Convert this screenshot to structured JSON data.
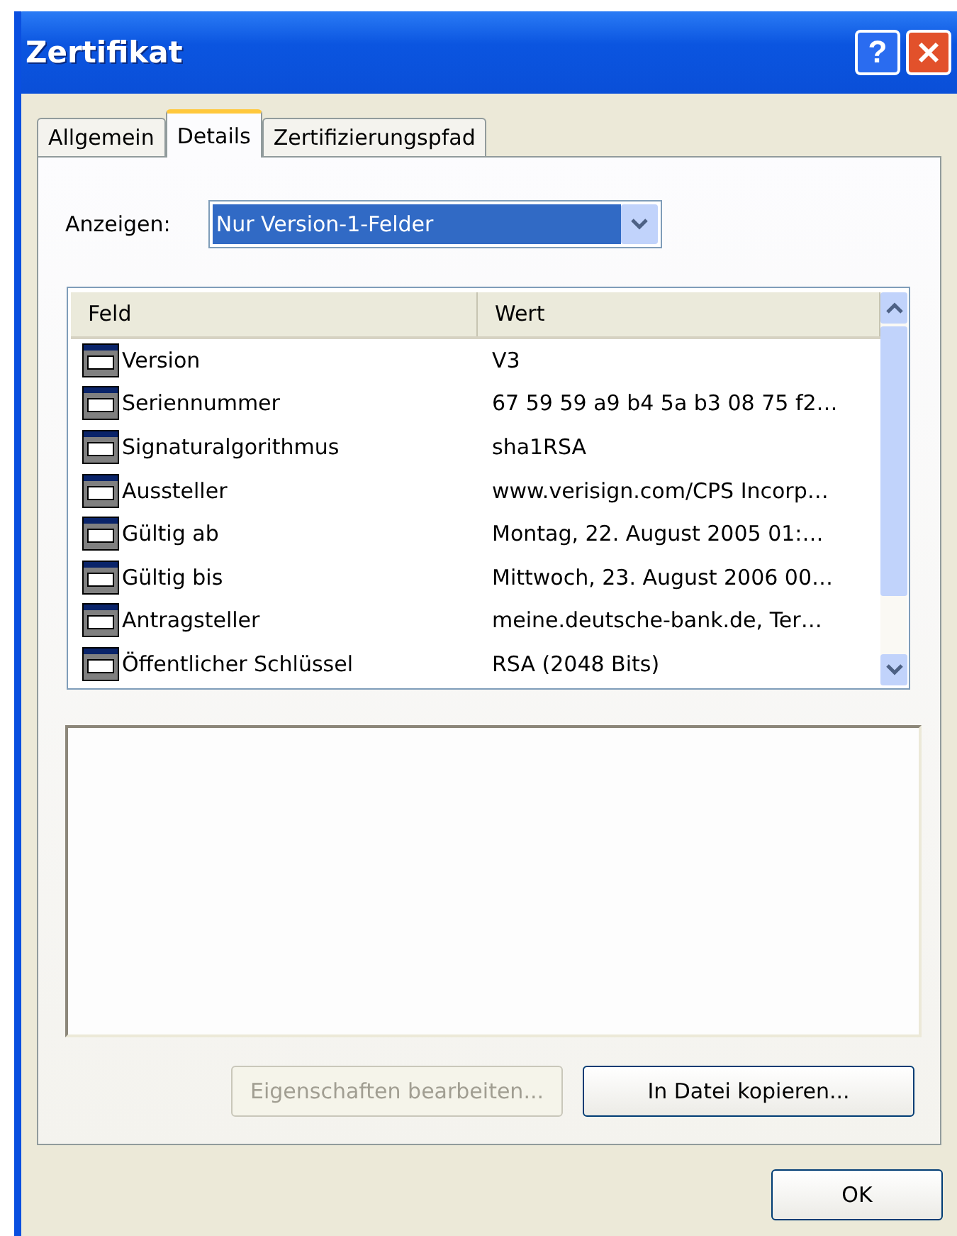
{
  "window": {
    "title": "Zertifikat",
    "help": "?"
  },
  "tabs": [
    {
      "label": "Allgemein",
      "selected": false
    },
    {
      "label": "Details",
      "selected": true
    },
    {
      "label": "Zertifizierungspfad",
      "selected": false
    }
  ],
  "show": {
    "label": "Anzeigen:",
    "value": "Nur Version-1-Felder"
  },
  "table": {
    "columns": [
      "Feld",
      "Wert"
    ],
    "rows": [
      {
        "field": "Version",
        "value": "V3",
        "selected": false
      },
      {
        "field": "Seriennummer",
        "value": "67 59 59 a9 b4 5a b3 08 75 f2…",
        "selected": false
      },
      {
        "field": "Signaturalgorithmus",
        "value": "sha1RSA",
        "selected": false
      },
      {
        "field": "Aussteller",
        "value": "www.verisign.com/CPS Incorp…",
        "selected": false
      },
      {
        "field": "Gültig ab",
        "value": "Montag, 22. August 2005 01:…",
        "selected": false
      },
      {
        "field": "Gültig bis",
        "value": "Mittwoch, 23. August 2006 00…",
        "selected": false
      },
      {
        "field": "Antragsteller",
        "value": "meine.deutsche-bank.de, Ter…",
        "selected": false
      },
      {
        "field": "Öffentlicher Schlüssel",
        "value": "RSA (2048 Bits)",
        "selected": false
      }
    ]
  },
  "buttons": [
    {
      "label": "Eigenschaften bearbeiten...",
      "disabled": true
    },
    {
      "label": "In Datei kopieren...",
      "disabled": false
    }
  ],
  "ok": "OK"
}
